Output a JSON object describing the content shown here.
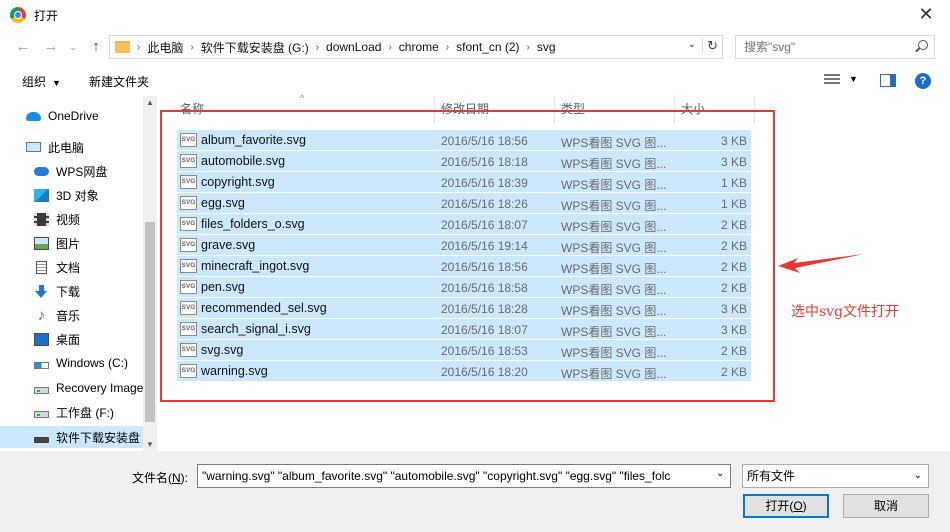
{
  "window": {
    "title": "打开"
  },
  "nav": {
    "back_icon": "arrow-left-icon",
    "forward_icon": "arrow-right-icon",
    "up_icon": "arrow-up-icon"
  },
  "address": {
    "breadcrumbs": [
      "此电脑",
      "软件下载安装盘 (G:)",
      "downLoad",
      "chrome",
      "sfont_cn (2)",
      "svg"
    ]
  },
  "search": {
    "placeholder": "搜索\"svg\""
  },
  "toolbar": {
    "organize": "组织",
    "new_folder": "新建文件夹"
  },
  "sidebar": {
    "items": [
      {
        "label": "OneDrive",
        "icon": "onedrive-icon"
      },
      {
        "label": "此电脑",
        "icon": "pc-icon"
      },
      {
        "label": "WPS网盘",
        "icon": "wps-cloud-icon"
      },
      {
        "label": "3D 对象",
        "icon": "3d-objects-icon"
      },
      {
        "label": "视频",
        "icon": "video-icon"
      },
      {
        "label": "图片",
        "icon": "picture-icon"
      },
      {
        "label": "文档",
        "icon": "document-icon"
      },
      {
        "label": "下载",
        "icon": "download-icon"
      },
      {
        "label": "音乐",
        "icon": "music-icon"
      },
      {
        "label": "桌面",
        "icon": "desktop-icon"
      },
      {
        "label": "Windows (C:)",
        "icon": "windows-drive-icon"
      },
      {
        "label": "Recovery Image",
        "icon": "drive-icon"
      },
      {
        "label": "工作盘 (F:)",
        "icon": "drive-icon"
      },
      {
        "label": "软件下载安装盘",
        "icon": "usb-drive-icon"
      }
    ]
  },
  "columns": {
    "name": "名称",
    "date": "修改日期",
    "type": "类型",
    "size": "大小"
  },
  "files": [
    {
      "name": "album_favorite.svg",
      "date": "2016/5/16 18:56",
      "type": "WPS看图 SVG 图...",
      "size": "3 KB"
    },
    {
      "name": "automobile.svg",
      "date": "2016/5/16 18:18",
      "type": "WPS看图 SVG 图...",
      "size": "3 KB"
    },
    {
      "name": "copyright.svg",
      "date": "2016/5/16 18:39",
      "type": "WPS看图 SVG 图...",
      "size": "1 KB"
    },
    {
      "name": "egg.svg",
      "date": "2016/5/16 18:26",
      "type": "WPS看图 SVG 图...",
      "size": "1 KB"
    },
    {
      "name": "files_folders_o.svg",
      "date": "2016/5/16 18:07",
      "type": "WPS看图 SVG 图...",
      "size": "2 KB"
    },
    {
      "name": "grave.svg",
      "date": "2016/5/16 19:14",
      "type": "WPS看图 SVG 图...",
      "size": "2 KB"
    },
    {
      "name": "minecraft_ingot.svg",
      "date": "2016/5/16 18:56",
      "type": "WPS看图 SVG 图...",
      "size": "2 KB"
    },
    {
      "name": "pen.svg",
      "date": "2016/5/16 18:58",
      "type": "WPS看图 SVG 图...",
      "size": "2 KB"
    },
    {
      "name": "recommended_sel.svg",
      "date": "2016/5/16 18:28",
      "type": "WPS看图 SVG 图...",
      "size": "3 KB"
    },
    {
      "name": "search_signal_i.svg",
      "date": "2016/5/16 18:07",
      "type": "WPS看图 SVG 图...",
      "size": "3 KB"
    },
    {
      "name": "svg.svg",
      "date": "2016/5/16 18:53",
      "type": "WPS看图 SVG 图...",
      "size": "2 KB"
    },
    {
      "name": "warning.svg",
      "date": "2016/5/16 18:20",
      "type": "WPS看图 SVG 图...",
      "size": "2 KB"
    }
  ],
  "annotation": {
    "text": "选中svg文件打开",
    "color": "#e53935"
  },
  "footer": {
    "filename_label": "文件名(",
    "filename_key": "N",
    "filename_label_end": "):",
    "filename_value": "\"warning.svg\" \"album_favorite.svg\" \"automobile.svg\" \"copyright.svg\" \"egg.svg\" \"files_folc",
    "filetype_value": "所有文件",
    "open_label": "打开(",
    "open_key": "O",
    "open_label_end": ")",
    "cancel_label": "取消"
  },
  "colors": {
    "selection": "#cce8ff",
    "accent": "#0078d7"
  }
}
